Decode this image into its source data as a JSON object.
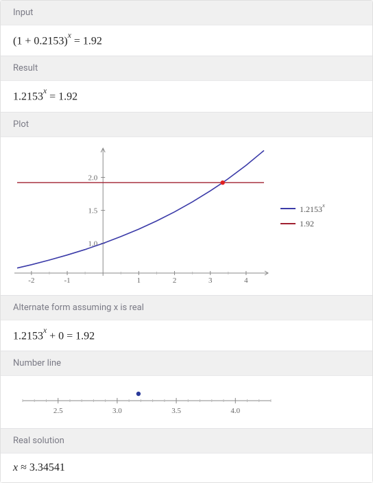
{
  "sections": {
    "input": {
      "title": "Input",
      "expression_html": "(1 + 0.2153)<sup>x</sup> = 1.92"
    },
    "result": {
      "title": "Result",
      "expression_html": "1.2153<sup>x</sup> = 1.92"
    },
    "plot": {
      "title": "Plot"
    },
    "altform": {
      "title": "Alternate form assuming x is real",
      "expression_html": "1.2153<sup>x</sup> + 0 = 1.92"
    },
    "numberline": {
      "title": "Number line"
    },
    "realsolution": {
      "title": "Real solution",
      "expression_html": "<span style='font-style:italic'>x</span> ≈ 3.34541"
    }
  },
  "chart_data": {
    "type": "line",
    "title": "",
    "xlabel": "",
    "ylabel": "",
    "xlim": [
      -2.4,
      4.5
    ],
    "ylim": [
      0.55,
      2.4
    ],
    "x_ticks": [
      -2,
      -1,
      1,
      2,
      3,
      4
    ],
    "y_ticks": [
      1.0,
      1.5,
      2.0
    ],
    "series": [
      {
        "name": "1.2153^x",
        "color": "#3a3aa8",
        "style": "curve",
        "x": [
          -2.4,
          -2,
          -1.5,
          -1,
          -0.5,
          0,
          0.5,
          1,
          1.5,
          2,
          2.5,
          3,
          3.34541,
          3.5,
          4,
          4.5
        ],
        "y": [
          0.626,
          0.677,
          0.747,
          0.823,
          0.907,
          1.0,
          1.103,
          1.2153,
          1.34,
          1.477,
          1.629,
          1.795,
          1.92,
          1.979,
          2.182,
          2.406
        ]
      },
      {
        "name": "1.92",
        "color": "#a02030",
        "style": "hline",
        "y_value": 1.92,
        "x_range": [
          -2.4,
          4.5
        ]
      }
    ],
    "intersection": {
      "x": 3.34541,
      "y": 1.92,
      "color": "#e02020"
    },
    "legend": [
      {
        "label_html": "1.2153<sup>x</sup>",
        "color": "#3a3aa8"
      },
      {
        "label_html": "1.92",
        "color": "#a02030"
      }
    ]
  },
  "numberline_data": {
    "ticks": [
      2.5,
      3.0,
      3.5,
      4.0
    ],
    "range": [
      2.2,
      4.3
    ],
    "point": 3.18
  }
}
